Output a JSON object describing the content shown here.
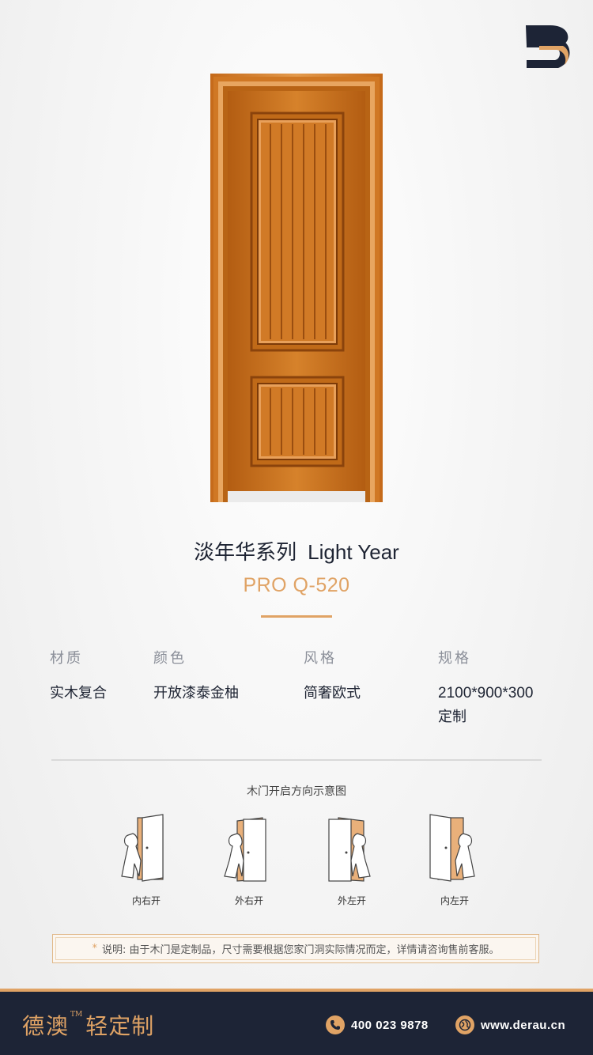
{
  "brand_logo": {
    "icon": "derau-logo-icon",
    "color_dark": "#1d2436",
    "color_accent": "#e0a365"
  },
  "product": {
    "series_cn": "淡年华系列",
    "series_en": "Light Year",
    "model": "PRO Q-520"
  },
  "specs": [
    {
      "label": "材质",
      "value": "实木复合"
    },
    {
      "label": "颜色",
      "value": "开放漆泰金柚"
    },
    {
      "label": "风格",
      "value": "简奢欧式"
    },
    {
      "label": "规格",
      "value": "2100*900*300",
      "value2": "定制"
    }
  ],
  "diagram": {
    "title": "木门开启方向示意图",
    "items": [
      {
        "label": "内右开"
      },
      {
        "label": "外右开"
      },
      {
        "label": "外左开"
      },
      {
        "label": "内左开"
      }
    ]
  },
  "note": {
    "star": "*",
    "text": "说明: 由于木门是定制品，尺寸需要根据您家门洞实际情况而定，详情请咨询售前客服。"
  },
  "footer": {
    "brand": "德澳",
    "tm": "TM",
    "slogan": "轻定制",
    "phone": "400 023 9878",
    "website": "www.derau.cn",
    "phone_icon": "phone-icon",
    "web_icon": "globe-icon"
  },
  "colors": {
    "accent": "#e0a365",
    "dark": "#1d2436",
    "door_wood": "#c9701c"
  }
}
